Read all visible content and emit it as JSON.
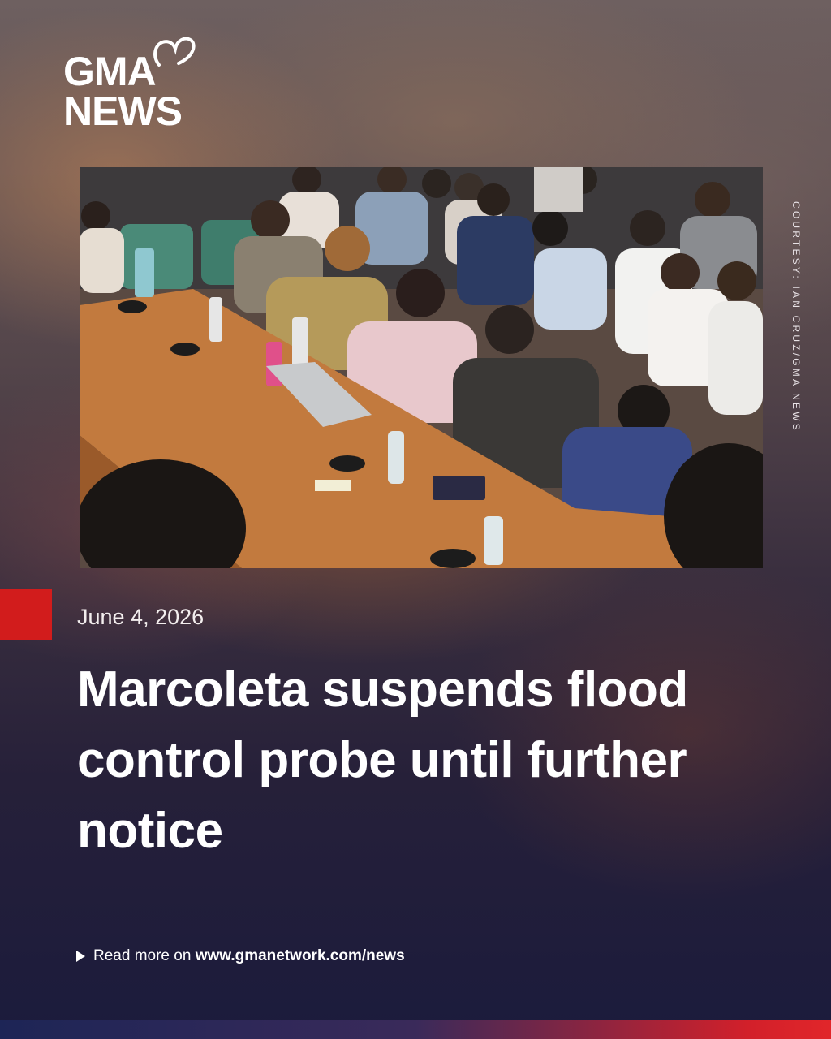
{
  "brand": {
    "line1": "GMA",
    "line2": "NEWS"
  },
  "photo": {
    "credit": "COURTESY: IAN CRUZ/GMA NEWS"
  },
  "article": {
    "date": "June 4, 2026",
    "headline": "Marcoleta suspends flood control probe until further notice"
  },
  "footer": {
    "read_more_prefix": "Read more on",
    "url": "www.gmanetwork.com/news"
  },
  "colors": {
    "accent_red": "#d21c1c",
    "text": "#ffffff"
  }
}
